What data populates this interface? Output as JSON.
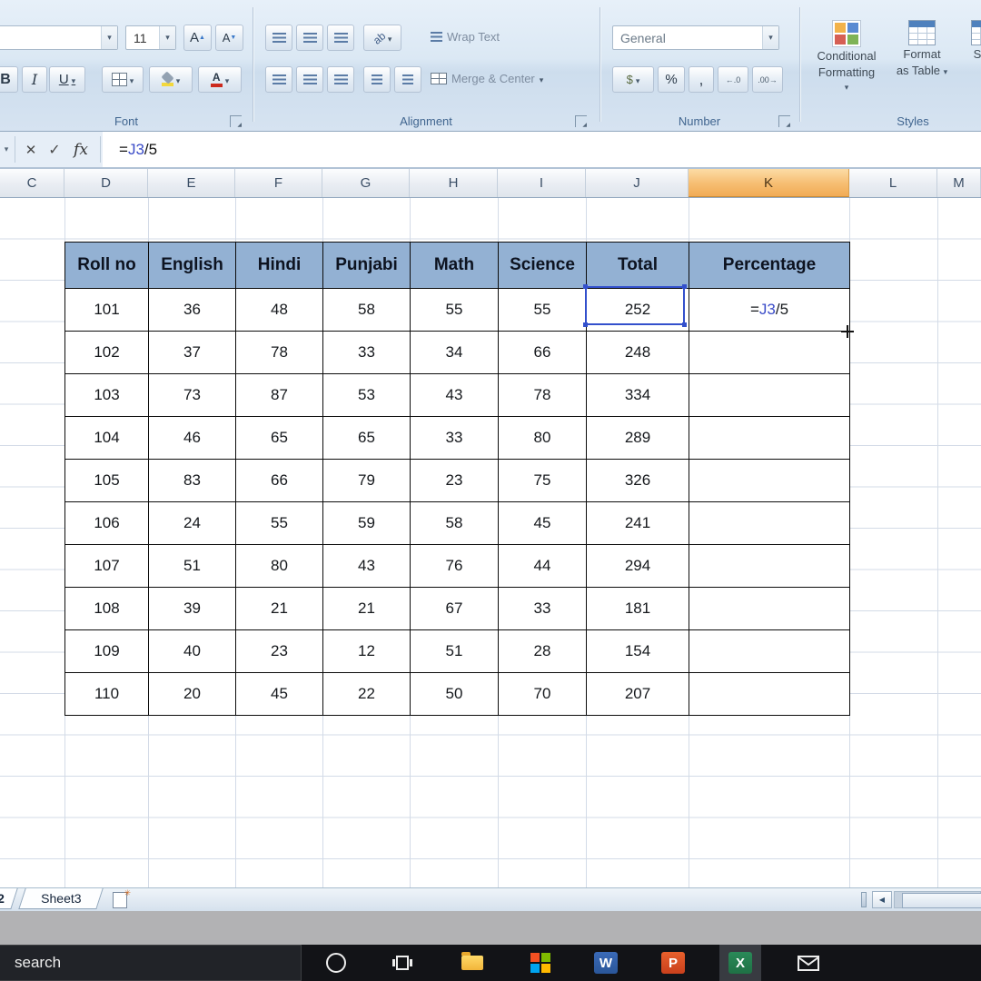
{
  "colors": {
    "table_header_fill": "#93b1d3",
    "selected_column_fill": "#f1ab55",
    "formula_ref_color": "#3b4cc8",
    "excel_green": "#1f7145"
  },
  "ribbon": {
    "groups": {
      "font": {
        "label": "Font"
      },
      "alignment": {
        "label": "Alignment"
      },
      "number": {
        "label": "Number"
      },
      "styles": {
        "label": "Styles"
      }
    },
    "font": {
      "size": "11",
      "bold": "B",
      "italic": "I",
      "underline": "U",
      "grow": "A",
      "shrink": "A",
      "font_color": "A"
    },
    "alignment": {
      "wrap_text": "Wrap Text",
      "merge_center": "Merge & Center",
      "orientation": "ab"
    },
    "number": {
      "format": "General",
      "accounting": "$",
      "percent": "%",
      "comma": ",",
      "increase_decimal": "←.0",
      "decrease_decimal": ".00→"
    },
    "styles": {
      "conditional_line1": "Conditional",
      "conditional_line2": "Formatting",
      "format_line1": "Format",
      "format_line2": "as Table",
      "partial": "S"
    }
  },
  "formula_bar": {
    "cancel": "✕",
    "enter": "✓",
    "fx": "fx",
    "formula": {
      "prefix": "=",
      "ref": "J3",
      "suffix": "/5"
    }
  },
  "sheet": {
    "columns": [
      "C",
      "D",
      "E",
      "F",
      "G",
      "H",
      "I",
      "J",
      "K",
      "L",
      "M"
    ],
    "selected_column": "K",
    "table": {
      "headers": [
        "Roll no",
        "English",
        "Hindi",
        "Punjabi",
        "Math",
        "Science",
        "Total",
        "Percentage"
      ],
      "rows": [
        {
          "values": [
            101,
            36,
            48,
            58,
            55,
            55,
            252
          ]
        },
        {
          "values": [
            102,
            37,
            78,
            33,
            34,
            66,
            248
          ]
        },
        {
          "values": [
            103,
            73,
            87,
            53,
            43,
            78,
            334
          ]
        },
        {
          "values": [
            104,
            46,
            65,
            65,
            33,
            80,
            289
          ]
        },
        {
          "values": [
            105,
            83,
            66,
            79,
            23,
            75,
            326
          ]
        },
        {
          "values": [
            106,
            24,
            55,
            59,
            58,
            45,
            241
          ]
        },
        {
          "values": [
            107,
            51,
            80,
            43,
            76,
            44,
            294
          ]
        },
        {
          "values": [
            108,
            39,
            21,
            21,
            67,
            33,
            181
          ]
        },
        {
          "values": [
            109,
            40,
            23,
            12,
            51,
            28,
            154
          ]
        },
        {
          "values": [
            110,
            20,
            45,
            22,
            50,
            70,
            207
          ]
        }
      ],
      "formula_cell": {
        "row_index": 0,
        "prefix": "=",
        "ref": "J3",
        "suffix": "/5"
      }
    }
  },
  "tabs": {
    "partial_tab": "2",
    "sheet_tab": "Sheet3"
  },
  "taskbar": {
    "search_text": "search",
    "word_letter": "W",
    "powerpoint_letter": "P",
    "excel_letter": "X"
  }
}
